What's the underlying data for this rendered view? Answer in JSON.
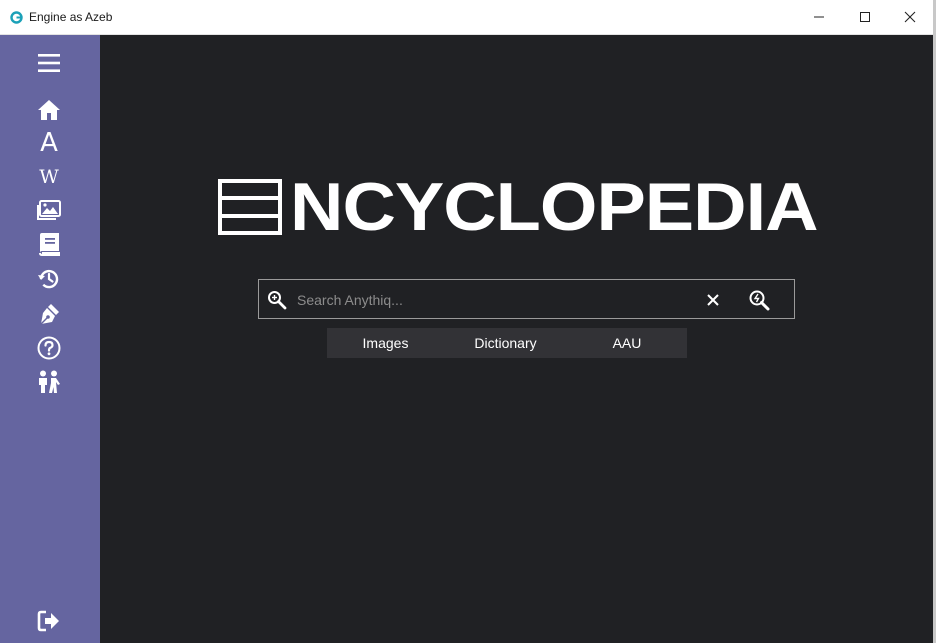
{
  "window": {
    "title": "Engine as Azeb"
  },
  "sidebar": {
    "items": [
      {
        "name": "menu-icon"
      },
      {
        "name": "home-icon"
      },
      {
        "name": "font-icon",
        "glyph": "A"
      },
      {
        "name": "wikipedia-icon",
        "glyph": "W"
      },
      {
        "name": "images-icon"
      },
      {
        "name": "book-icon"
      },
      {
        "name": "history-icon"
      },
      {
        "name": "pen-icon"
      },
      {
        "name": "help-icon"
      },
      {
        "name": "people-icon"
      },
      {
        "name": "logout-icon"
      }
    ]
  },
  "logo": {
    "text": "NCYCLOPEDIA"
  },
  "search": {
    "placeholder": "Search Anythiq...",
    "value": ""
  },
  "tabs": [
    {
      "label": "Images"
    },
    {
      "label": "Dictionary"
    },
    {
      "label": "AAU"
    }
  ],
  "colors": {
    "sidebar": "#6565a0",
    "background": "#202124",
    "tab_bar": "#323236",
    "text": "#ffffff"
  }
}
